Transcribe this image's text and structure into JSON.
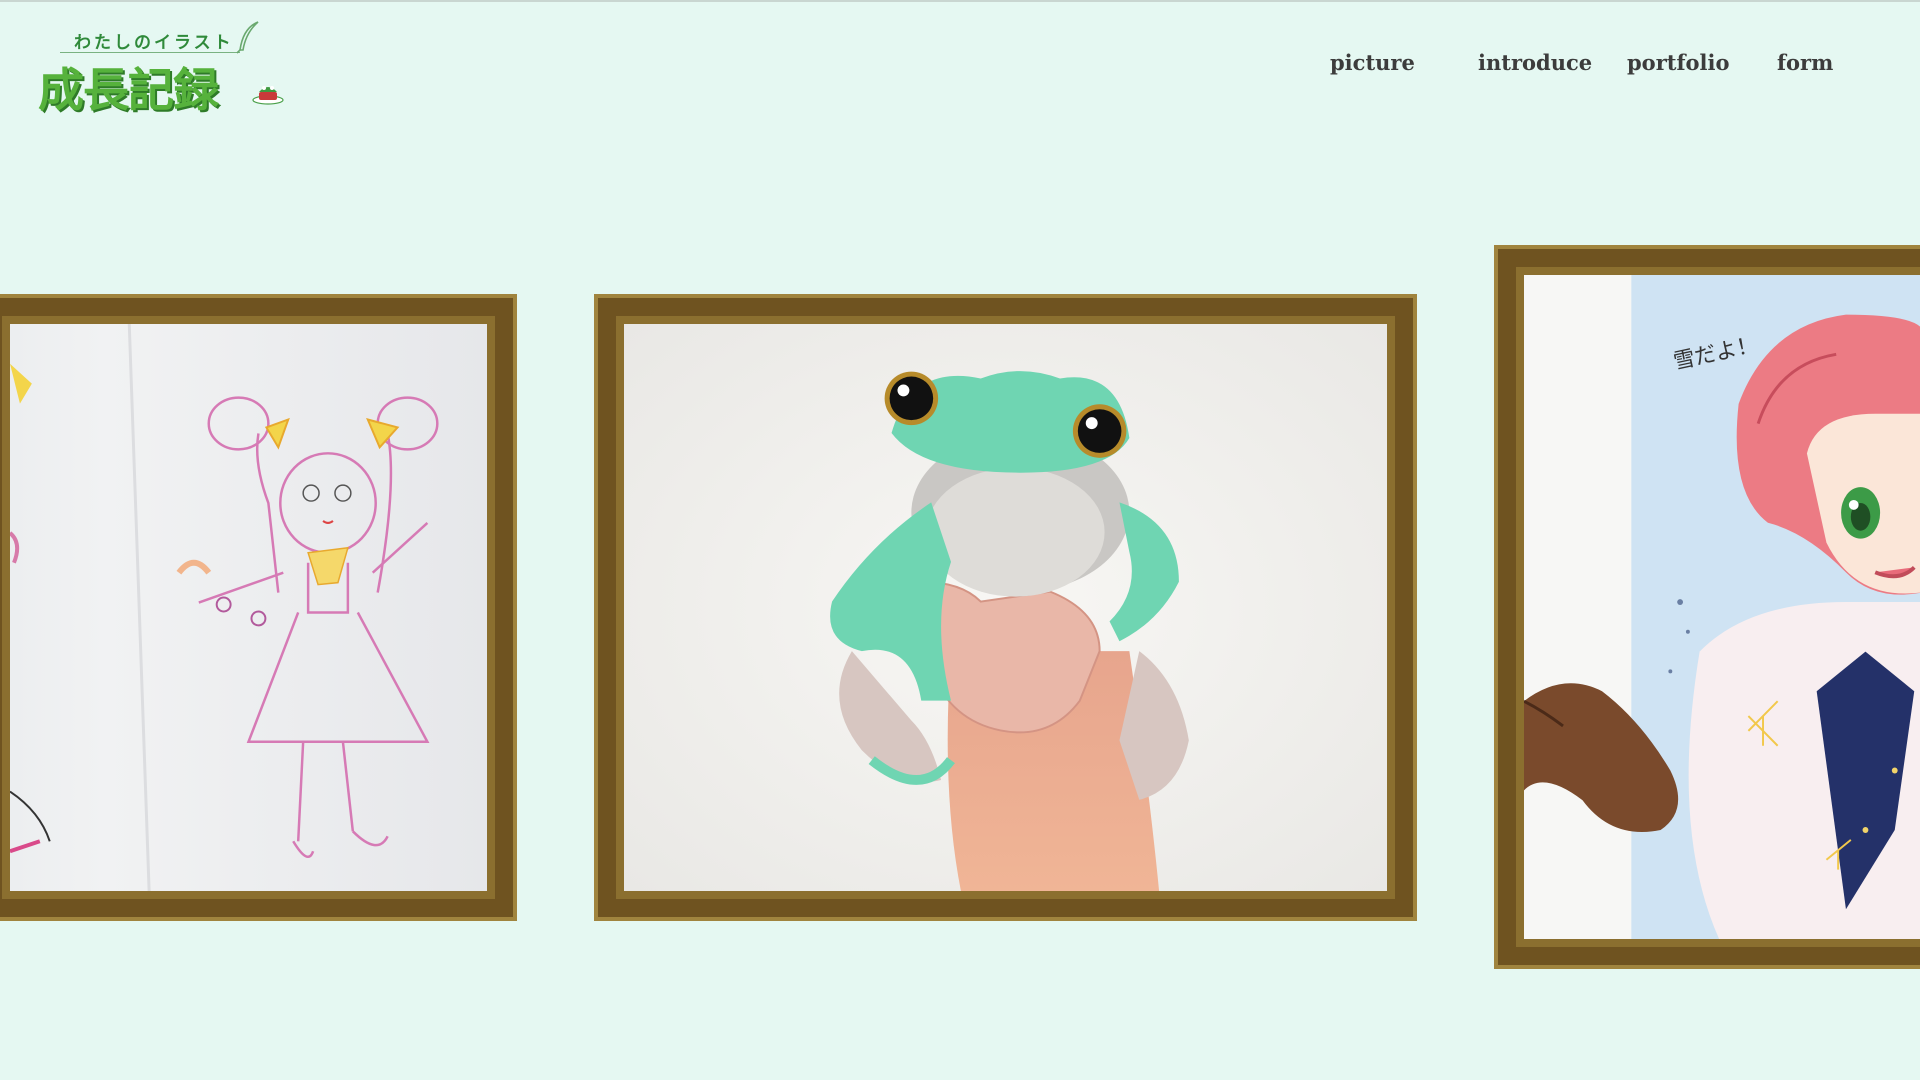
{
  "logo": {
    "subtitle": "わたしのイラスト",
    "title": "成長記録",
    "quill_icon": "quill-icon",
    "badge_icon": "frog-cake-icon"
  },
  "nav": {
    "items": [
      {
        "label": "picture"
      },
      {
        "label": "introduce"
      },
      {
        "label": "portfolio"
      },
      {
        "label": "form"
      }
    ]
  },
  "gallery": {
    "frames": [
      {
        "subject": "child crayon drawing of girl"
      },
      {
        "subject": "painted green frog on finger"
      },
      {
        "subject": "anime girl with pink hair",
        "caption": "雪だよ！"
      }
    ]
  },
  "colors": {
    "background": "#e5f8f2",
    "frame": "#8b6f2f",
    "logo_green": "#56b23c"
  }
}
